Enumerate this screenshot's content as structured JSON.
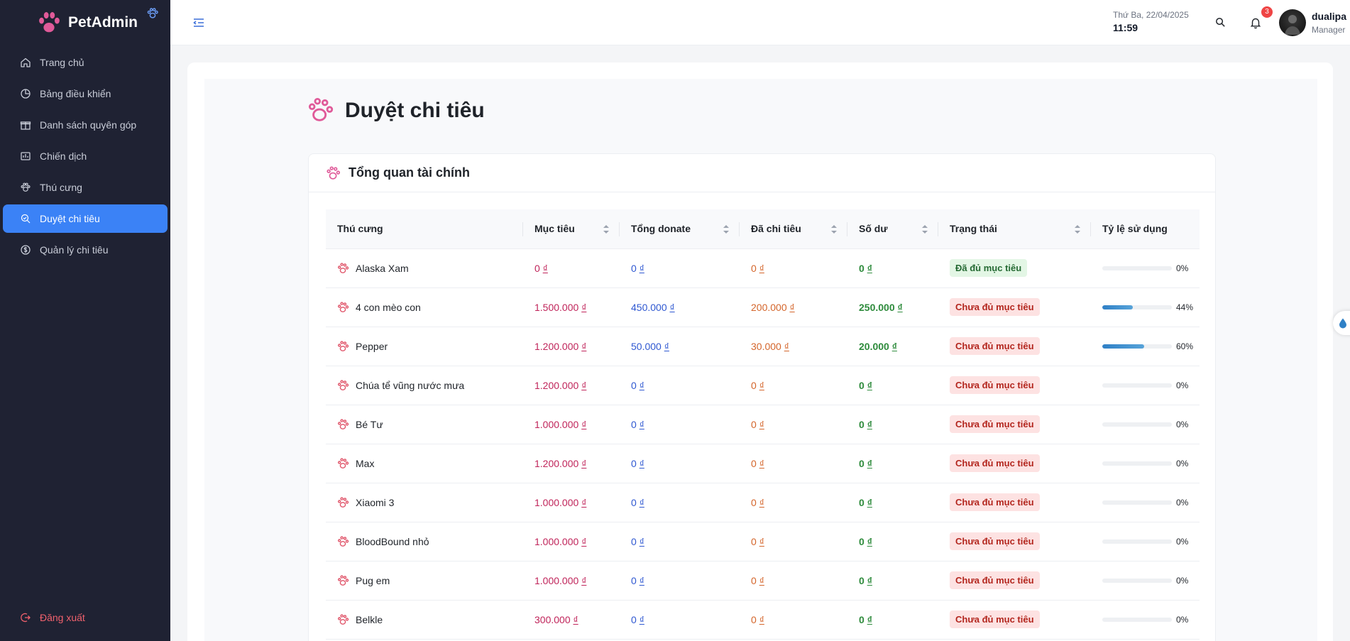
{
  "app": {
    "name": "PetAdmin",
    "brand_color": "#e05a99",
    "accent": "#3b82f6"
  },
  "sidebar": {
    "items": [
      {
        "label": "Trang chủ",
        "icon": "home-icon",
        "active": false
      },
      {
        "label": "Bảng điều khiển",
        "icon": "dashboard-icon",
        "active": false
      },
      {
        "label": "Danh sách quyên góp",
        "icon": "gift-icon",
        "active": false
      },
      {
        "label": "Chiến dịch",
        "icon": "campaign-icon",
        "active": false
      },
      {
        "label": "Thú cưng",
        "icon": "paw-icon",
        "active": false
      },
      {
        "label": "Duyệt chi tiêu",
        "icon": "approve-icon",
        "active": true
      },
      {
        "label": "Quản lý chi tiêu",
        "icon": "money-icon",
        "active": false
      }
    ],
    "logout_label": "Đăng xuất"
  },
  "header": {
    "date": "Thứ Ba, 22/04/2025",
    "time": "11:59",
    "notification_count": "3",
    "user_name": "dualipa",
    "user_role": "Manager"
  },
  "page": {
    "title": "Duyệt chi tiêu",
    "card_title": "Tổng quan tài chính"
  },
  "table": {
    "columns": [
      "Thú cưng",
      "Mục tiêu",
      "Tổng donate",
      "Đã chi tiêu",
      "Số dư",
      "Trạng thái",
      "Tỷ lệ sử dụng"
    ],
    "currency_symbol": "₫",
    "rows": [
      {
        "pet": "Alaska Xam",
        "goal": "0",
        "donate": "0",
        "spent": "0",
        "balance": "0",
        "status": "Đã đủ mục tiêu",
        "status_ok": true,
        "usage": 0,
        "usage_label": "0%"
      },
      {
        "pet": "4 con mèo con",
        "goal": "1.500.000",
        "donate": "450.000",
        "spent": "200.000",
        "balance": "250.000",
        "status": "Chưa đủ mục tiêu",
        "status_ok": false,
        "usage": 44,
        "usage_label": "44%"
      },
      {
        "pet": "Pepper",
        "goal": "1.200.000",
        "donate": "50.000",
        "spent": "30.000",
        "balance": "20.000",
        "status": "Chưa đủ mục tiêu",
        "status_ok": false,
        "usage": 60,
        "usage_label": "60%"
      },
      {
        "pet": "Chúa tể vũng nước mưa",
        "goal": "1.200.000",
        "donate": "0",
        "spent": "0",
        "balance": "0",
        "status": "Chưa đủ mục tiêu",
        "status_ok": false,
        "usage": 0,
        "usage_label": "0%"
      },
      {
        "pet": "Bé Tư",
        "goal": "1.000.000",
        "donate": "0",
        "spent": "0",
        "balance": "0",
        "status": "Chưa đủ mục tiêu",
        "status_ok": false,
        "usage": 0,
        "usage_label": "0%"
      },
      {
        "pet": "Max",
        "goal": "1.200.000",
        "donate": "0",
        "spent": "0",
        "balance": "0",
        "status": "Chưa đủ mục tiêu",
        "status_ok": false,
        "usage": 0,
        "usage_label": "0%"
      },
      {
        "pet": "Xiaomi 3",
        "goal": "1.000.000",
        "donate": "0",
        "spent": "0",
        "balance": "0",
        "status": "Chưa đủ mục tiêu",
        "status_ok": false,
        "usage": 0,
        "usage_label": "0%"
      },
      {
        "pet": "BloodBound nhỏ",
        "goal": "1.000.000",
        "donate": "0",
        "spent": "0",
        "balance": "0",
        "status": "Chưa đủ mục tiêu",
        "status_ok": false,
        "usage": 0,
        "usage_label": "0%"
      },
      {
        "pet": "Pug em",
        "goal": "1.000.000",
        "donate": "0",
        "spent": "0",
        "balance": "0",
        "status": "Chưa đủ mục tiêu",
        "status_ok": false,
        "usage": 0,
        "usage_label": "0%"
      },
      {
        "pet": "Belkle",
        "goal": "300.000",
        "donate": "0",
        "spent": "0",
        "balance": "0",
        "status": "Chưa đủ mục tiêu",
        "status_ok": false,
        "usage": 0,
        "usage_label": "0%"
      }
    ]
  }
}
